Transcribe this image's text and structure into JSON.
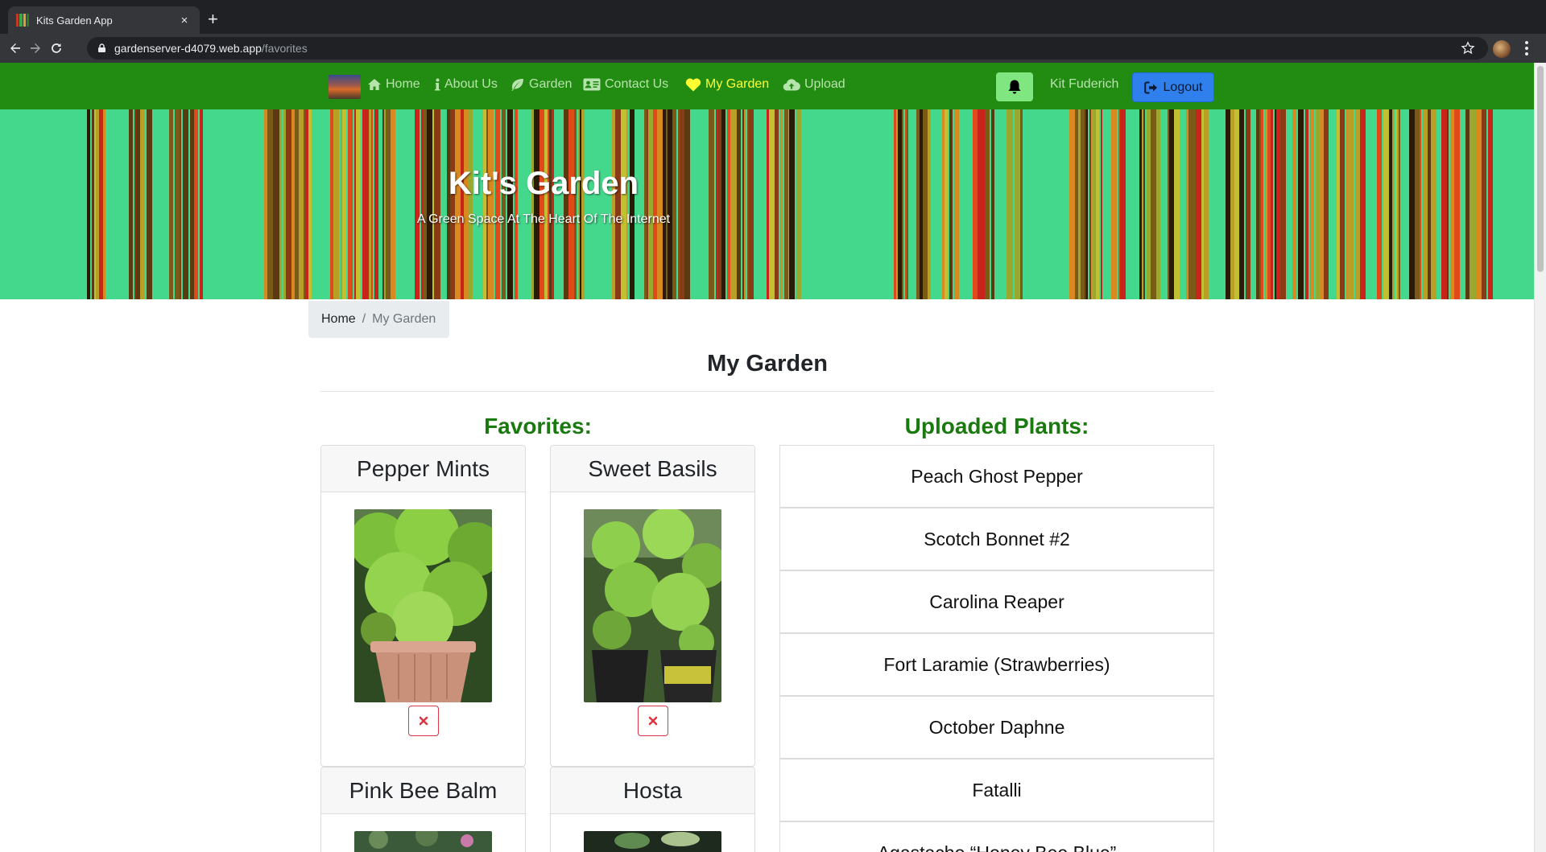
{
  "browser": {
    "tab_title": "Kits Garden App",
    "tab_close": "×",
    "new_tab": "+",
    "url_host": "gardenserver-d4079.web.app",
    "url_path": "/favorites"
  },
  "navbar": {
    "items": [
      {
        "label": "Home",
        "icon": "home-icon"
      },
      {
        "label": "About Us",
        "icon": "info-icon"
      },
      {
        "label": "Garden",
        "icon": "leaf-icon"
      },
      {
        "label": "Contact Us",
        "icon": "address-card-icon"
      },
      {
        "label": "My Garden",
        "icon": "heart-icon",
        "active": true
      },
      {
        "label": "Upload",
        "icon": "cloud-upload-icon"
      }
    ],
    "username": "Kit Fuderich",
    "logout_label": "Logout"
  },
  "banner": {
    "title": "Kit's Garden",
    "subtitle": "A Green Space At The Heart Of The Internet"
  },
  "breadcrumb": {
    "home": "Home",
    "separator": "/",
    "current": "My Garden"
  },
  "main": {
    "title": "My Garden",
    "favorites_heading": "Favorites:",
    "uploaded_heading": "Uploaded Plants:",
    "favorites": [
      {
        "name": "Pepper Mints"
      },
      {
        "name": "Sweet Basils"
      },
      {
        "name": "Pink Bee Balm"
      },
      {
        "name": "Hosta"
      }
    ],
    "uploaded_plants": [
      "Peach Ghost Pepper",
      "Scotch Bonnet #2",
      "Carolina Reaper",
      "Fort Laramie (Strawberries)",
      "October Daphne",
      "Fatalli",
      "Agastache “Honey Bee Blue”"
    ]
  },
  "colors": {
    "navbar_bg": "#228b11",
    "nav_link": "#b7e3ad",
    "nav_active": "#ffff33",
    "banner_bg": "#44d88c",
    "section_heading": "#1a7a10",
    "logout_bg": "#2f80ed",
    "bell_bg": "#80e680",
    "remove_red": "#dc3545"
  }
}
